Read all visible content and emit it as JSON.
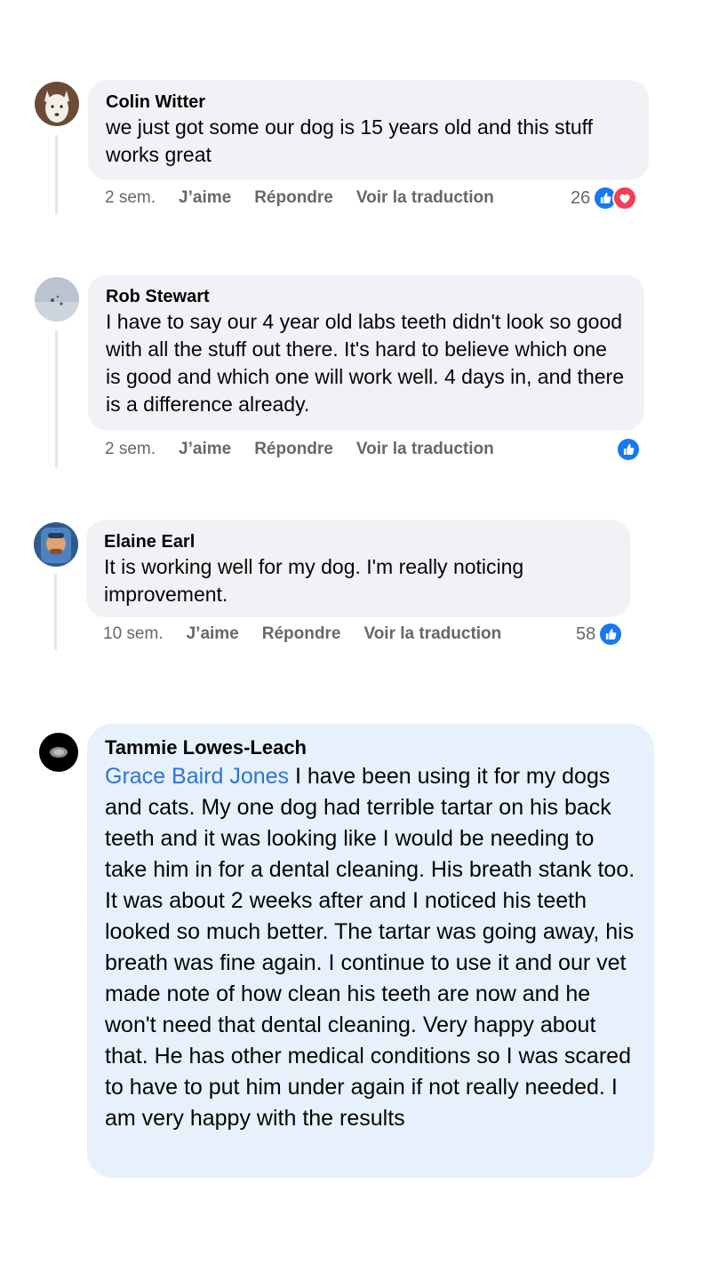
{
  "comments": [
    {
      "author": "Colin Witter",
      "text": "we just got some our dog is 15 years old and this stuff works great",
      "time": "2 sem.",
      "like_label": "J’aime",
      "reply_label": "Répondre",
      "translate_label": "Voir la traduction",
      "reaction_count": "26",
      "reactions": [
        "like-icon",
        "love-icon"
      ]
    },
    {
      "author": "Rob Stewart",
      "text": "I have to say our 4 year old labs teeth didn't look so good with all the stuff out there. It's hard to believe which one is good and which one will work well. 4 days in, and there is a difference already.",
      "time": "2 sem.",
      "like_label": "J’aime",
      "reply_label": "Répondre",
      "translate_label": "Voir la traduction",
      "reaction_count": "",
      "reactions": [
        "like-icon"
      ]
    },
    {
      "author": "Elaine Earl",
      "text": "It is working well for my dog. I'm really noticing improvement.",
      "time": "10 sem.",
      "like_label": "J’aime",
      "reply_label": "Répondre",
      "translate_label": "Voir la traduction",
      "reaction_count": "58",
      "reactions": [
        "like-icon"
      ]
    },
    {
      "author": "Tammie Lowes-Leach",
      "mention": "Grace Baird Jones",
      "text": " I have been using it for my dogs and cats. My one dog had terrible tartar on his back teeth and it was looking like I would be needing to take him in for a dental cleaning. His breath stank too. It was about 2 weeks after and I noticed his teeth looked so much better. The tartar was going away, his breath was fine again. I continue to use it and our vet made note of how clean his teeth are now and he won't need that dental cleaning. Very happy about that. He has other medical conditions so I was scared to have to put him under again if not really needed. I am very happy with the results"
    }
  ],
  "colors": {
    "bubble": "#f0f2f5",
    "highlight_bubble": "#e7f1fc",
    "mention": "#2d74d5",
    "like_blue": "#1877f2",
    "love_red": "#f33e58",
    "meta_gray": "#65676b"
  }
}
